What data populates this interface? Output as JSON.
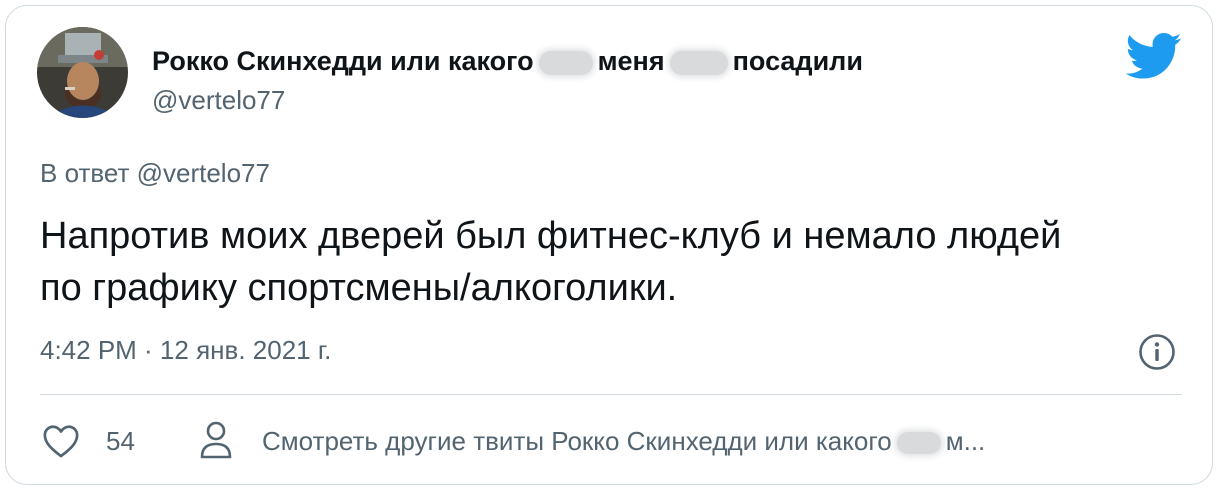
{
  "author": {
    "name_parts": [
      "Рокко Скинхедди или какого",
      "меня",
      "посадили"
    ],
    "handle": "@vertelo77"
  },
  "reply_to": "В ответ @vertelo77",
  "tweet_text_lines": [
    "Напротив моих дверей был фитнес-клуб и немало людей",
    "по графику спортсмены/алкоголики."
  ],
  "timestamp": "4:42 PM · 12 янв. 2021 г.",
  "likes": "54",
  "more_tweets": {
    "prefix": "Смотреть другие твиты Рокко Скинхедди или какого",
    "suffix": "м..."
  },
  "icons": {
    "logo": "twitter-bird-icon",
    "info": "info-icon",
    "like": "heart-icon",
    "profile": "person-icon"
  },
  "colors": {
    "twitter_blue": "#1d9bf0",
    "secondary_text": "#536471",
    "primary_text": "#0f1419"
  }
}
